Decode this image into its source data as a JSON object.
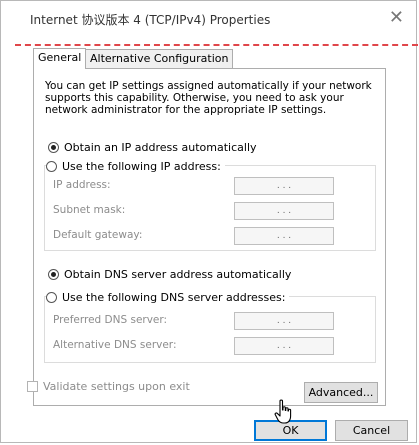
{
  "window": {
    "title": "Internet 协议版本 4 (TCP/IPv4) Properties",
    "close_glyph": "✕"
  },
  "tabs": [
    {
      "label": "General"
    },
    {
      "label": "Alternative Configuration"
    }
  ],
  "description": "You can get IP settings assigned automatically if your network supports this capability. Otherwise, you need to ask your network administrator for the appropriate IP settings.",
  "ip": {
    "auto_label": "Obtain an IP address automatically",
    "manual_label": "Use the following IP address:",
    "fields": [
      {
        "label": "IP address:",
        "value": ".   .   ."
      },
      {
        "label": "Subnet mask:",
        "value": ".   .   ."
      },
      {
        "label": "Default gateway:",
        "value": ".   .   ."
      }
    ]
  },
  "dns": {
    "auto_label": "Obtain DNS server address automatically",
    "manual_label": "Use the following DNS server addresses:",
    "fields": [
      {
        "label": "Preferred DNS server:",
        "value": ".   .   ."
      },
      {
        "label": "Alternative DNS server:",
        "value": ".   .   ."
      }
    ]
  },
  "validate_label": "Validate settings upon exit",
  "buttons": {
    "advanced": "Advanced...",
    "ok": "OK",
    "cancel": "Cancel"
  },
  "colors": {
    "annotation_dash": "#e0464a"
  },
  "icons": {
    "cursor": "hand-pointer-icon"
  }
}
